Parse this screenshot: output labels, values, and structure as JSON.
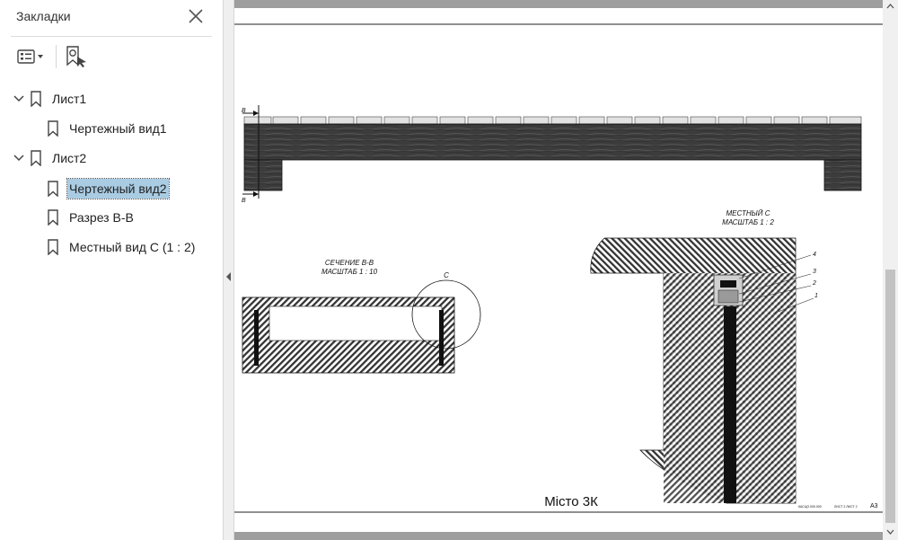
{
  "bookmarks_panel": {
    "title": "Закладки",
    "items": [
      {
        "label": "Лист1",
        "expanded": true
      },
      {
        "label": "Чертежный вид1"
      },
      {
        "label": "Лист2",
        "expanded": true
      },
      {
        "label": "Чертежный вид2",
        "selected": true
      },
      {
        "label": "Разрез В-В"
      },
      {
        "label": "Местный вид  С (1 : 2)"
      }
    ],
    "toolbar_icons": [
      "options-menu-icon",
      "add-bookmark-icon"
    ]
  },
  "drawing": {
    "section_title": "СЕЧЕНИЕ В-В",
    "section_scale": "МАСШТАБ 1 : 10",
    "local_title": "МЕСТНЫЙ  С",
    "local_scale": "МАСШТАБ 1 : 2",
    "section_mark_top": "В",
    "section_mark_bottom": "В",
    "detail_mark": "С",
    "callouts": [
      "4",
      "3",
      "2",
      "1"
    ],
    "stamp_title": "Місто 3К",
    "stamp_code_1": "КАСЦО.000.000",
    "stamp_code_2": "ЛИСТ 2 ЛИСТ 2",
    "format": "А3"
  },
  "colors": {
    "selection": "#a9cce3",
    "viewer_background": "#9e9e9e",
    "wood_dark": "#3e3e3e"
  }
}
